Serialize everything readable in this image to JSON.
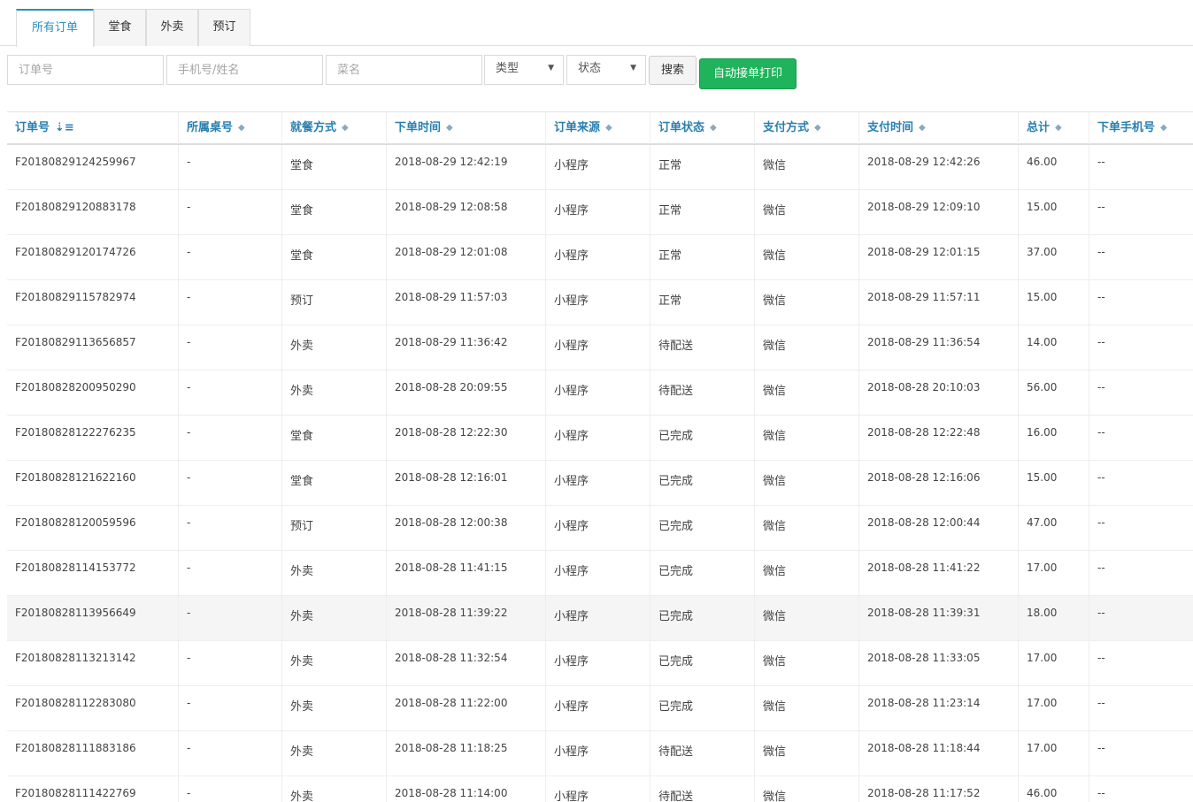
{
  "tabs": [
    {
      "label": "所有订单",
      "active": true
    },
    {
      "label": "堂食",
      "active": false
    },
    {
      "label": "外卖",
      "active": false
    },
    {
      "label": "预订",
      "active": false
    }
  ],
  "filters": {
    "order_no_placeholder": "订单号",
    "phone_placeholder": "手机号/姓名",
    "dish_placeholder": "菜名",
    "type_select": "类型",
    "status_select": "状态",
    "search_label": "搜索",
    "auto_print_label": "自动接单打印"
  },
  "table": {
    "columns": [
      "订单号",
      "所属桌号",
      "就餐方式",
      "下单时间",
      "订单来源",
      "订单状态",
      "支付方式",
      "支付时间",
      "总计",
      "下单手机号"
    ],
    "rows": [
      [
        "F20180829124259967",
        "-",
        "堂食",
        "2018-08-29 12:42:19",
        "小程序",
        "正常",
        "微信",
        "2018-08-29 12:42:26",
        "46.00",
        "--"
      ],
      [
        "F20180829120883178",
        "-",
        "堂食",
        "2018-08-29 12:08:58",
        "小程序",
        "正常",
        "微信",
        "2018-08-29 12:09:10",
        "15.00",
        "--"
      ],
      [
        "F20180829120174726",
        "-",
        "堂食",
        "2018-08-29 12:01:08",
        "小程序",
        "正常",
        "微信",
        "2018-08-29 12:01:15",
        "37.00",
        "--"
      ],
      [
        "F20180829115782974",
        "-",
        "预订",
        "2018-08-29 11:57:03",
        "小程序",
        "正常",
        "微信",
        "2018-08-29 11:57:11",
        "15.00",
        "--"
      ],
      [
        "F20180829113656857",
        "-",
        "外卖",
        "2018-08-29 11:36:42",
        "小程序",
        "待配送",
        "微信",
        "2018-08-29 11:36:54",
        "14.00",
        "--"
      ],
      [
        "F20180828200950290",
        "-",
        "外卖",
        "2018-08-28 20:09:55",
        "小程序",
        "待配送",
        "微信",
        "2018-08-28 20:10:03",
        "56.00",
        "--"
      ],
      [
        "F20180828122276235",
        "-",
        "堂食",
        "2018-08-28 12:22:30",
        "小程序",
        "已完成",
        "微信",
        "2018-08-28 12:22:48",
        "16.00",
        "--"
      ],
      [
        "F20180828121622160",
        "-",
        "堂食",
        "2018-08-28 12:16:01",
        "小程序",
        "已完成",
        "微信",
        "2018-08-28 12:16:06",
        "15.00",
        "--"
      ],
      [
        "F20180828120059596",
        "-",
        "预订",
        "2018-08-28 12:00:38",
        "小程序",
        "已完成",
        "微信",
        "2018-08-28 12:00:44",
        "47.00",
        "--"
      ],
      [
        "F20180828114153772",
        "-",
        "外卖",
        "2018-08-28 11:41:15",
        "小程序",
        "已完成",
        "微信",
        "2018-08-28 11:41:22",
        "17.00",
        "--"
      ],
      [
        "F20180828113956649",
        "-",
        "外卖",
        "2018-08-28 11:39:22",
        "小程序",
        "已完成",
        "微信",
        "2018-08-28 11:39:31",
        "18.00",
        "--"
      ],
      [
        "F20180828113213142",
        "-",
        "外卖",
        "2018-08-28 11:32:54",
        "小程序",
        "已完成",
        "微信",
        "2018-08-28 11:33:05",
        "17.00",
        "--"
      ],
      [
        "F20180828112283080",
        "-",
        "外卖",
        "2018-08-28 11:22:00",
        "小程序",
        "已完成",
        "微信",
        "2018-08-28 11:23:14",
        "17.00",
        "--"
      ],
      [
        "F20180828111883186",
        "-",
        "外卖",
        "2018-08-28 11:18:25",
        "小程序",
        "待配送",
        "微信",
        "2018-08-28 11:18:44",
        "17.00",
        "--"
      ],
      [
        "F20180828111422769",
        "-",
        "外卖",
        "2018-08-28 11:14:00",
        "小程序",
        "待配送",
        "微信",
        "2018-08-28 11:17:52",
        "46.00",
        "--"
      ]
    ]
  },
  "colors": {
    "accent": "#2a8fbd",
    "header_text": "#2a7fb0",
    "success_button": "#1fb45b",
    "highlight_row": "#f5f5f5"
  }
}
